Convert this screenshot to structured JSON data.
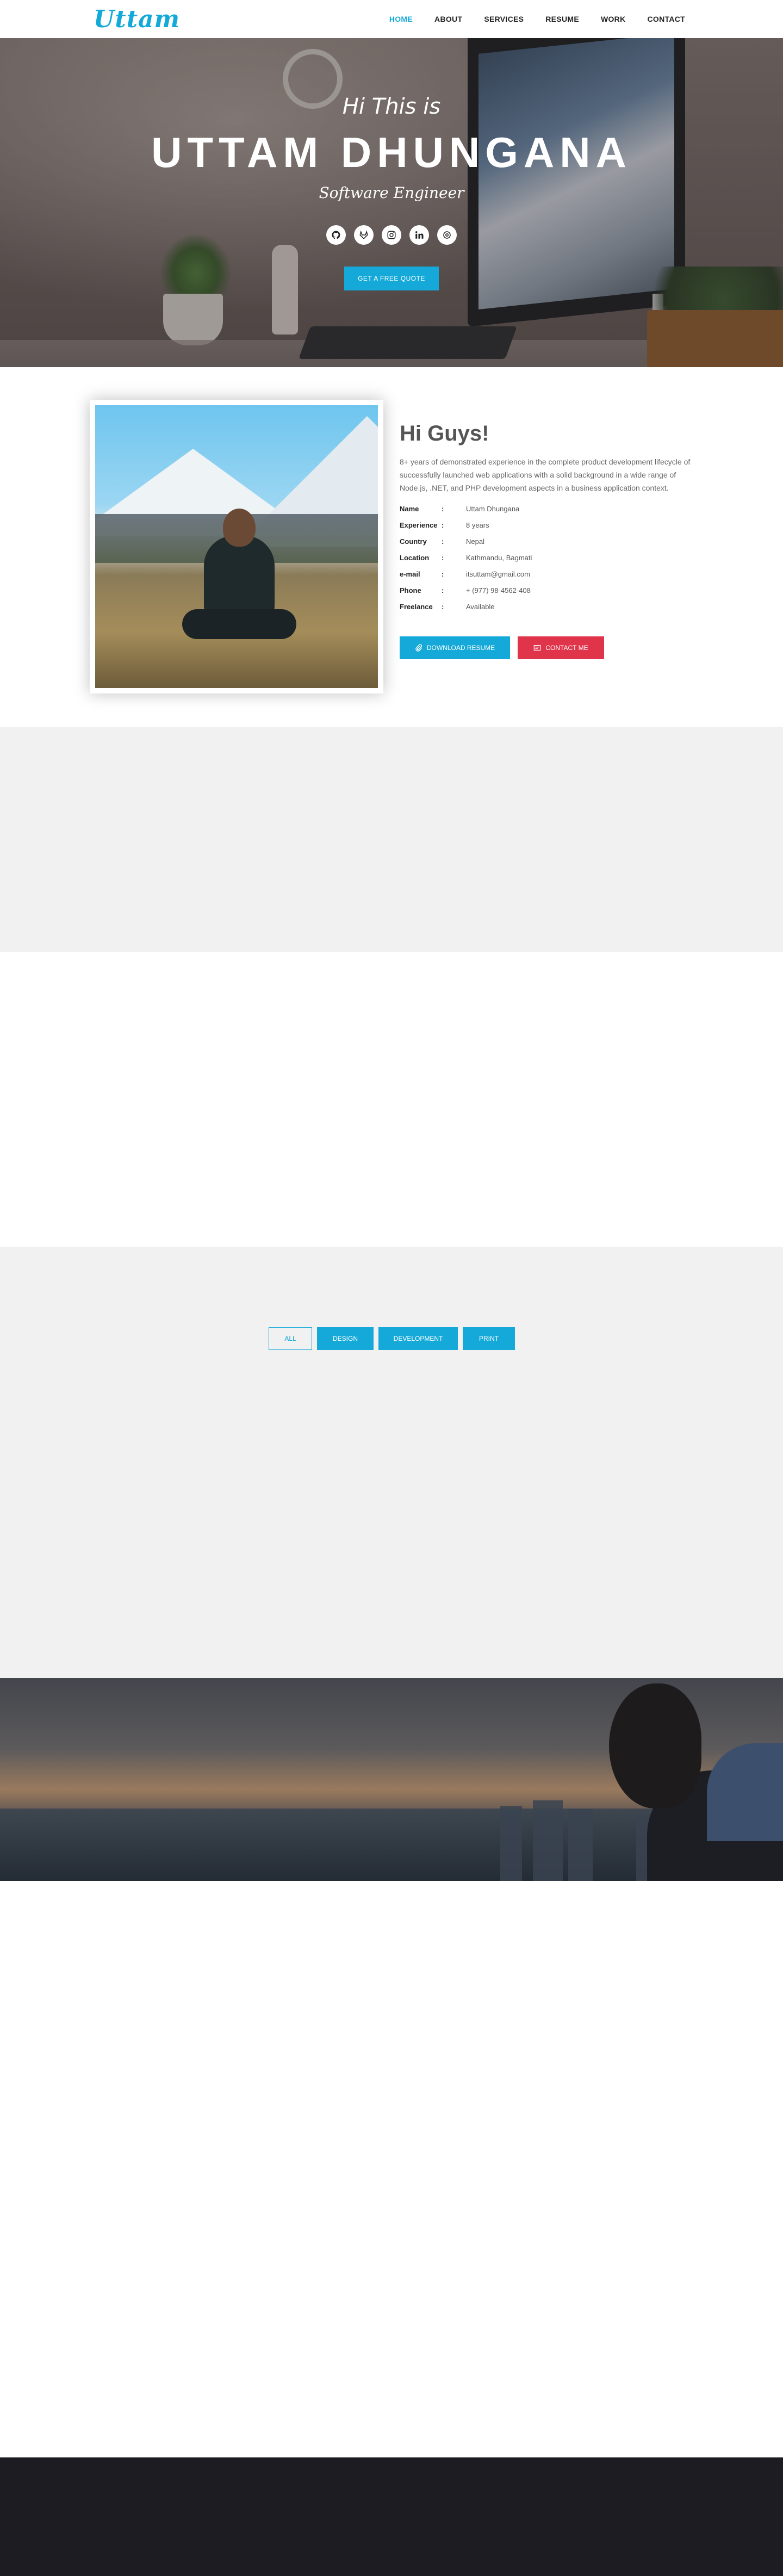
{
  "brand": {
    "logo_text": "Uttam",
    "accent_color": "#14a9d8",
    "danger_color": "#e0344b"
  },
  "nav": {
    "items": [
      {
        "label": "HOME",
        "active": true
      },
      {
        "label": "ABOUT",
        "active": false
      },
      {
        "label": "SERVICES",
        "active": false
      },
      {
        "label": "RESUME",
        "active": false
      },
      {
        "label": "WORK",
        "active": false
      },
      {
        "label": "CONTACT",
        "active": false
      }
    ]
  },
  "hero": {
    "greeting": "Hi This is",
    "name": "UTTAM DHUNGANA",
    "role": "Software Engineer",
    "socials": [
      "github-icon",
      "gitlab-icon",
      "instagram-icon",
      "linkedin-icon",
      "stackoverflow-icon"
    ],
    "cta_label": "GET A FREE QUOTE"
  },
  "about": {
    "title": "Hi Guys!",
    "description": "8+ years of demonstrated experience in the complete product development lifecycle of successfully launched web applications with a solid background in a wide range of Node.js, .NET, and PHP development aspects in a business application context.",
    "info": [
      {
        "label": "Name",
        "value": "Uttam Dhungana"
      },
      {
        "label": "Experience",
        "value": "8 years"
      },
      {
        "label": "Country",
        "value": "Nepal"
      },
      {
        "label": "Location",
        "value": "Kathmandu, Bagmati"
      },
      {
        "label": "e-mail",
        "value": "itsuttam@gmail.com"
      },
      {
        "label": "Phone",
        "value": "+ (977) 98-4562-408"
      },
      {
        "label": "Freelance",
        "value": "Available"
      }
    ],
    "download_label": "DOWNLOAD RESUME",
    "contact_label": "CONTACT ME"
  },
  "work": {
    "filters": [
      {
        "label": "ALL",
        "active": true
      },
      {
        "label": "DESIGN",
        "active": false
      },
      {
        "label": "DEVELOPMENT",
        "active": false
      },
      {
        "label": "PRINT",
        "active": false
      }
    ]
  }
}
